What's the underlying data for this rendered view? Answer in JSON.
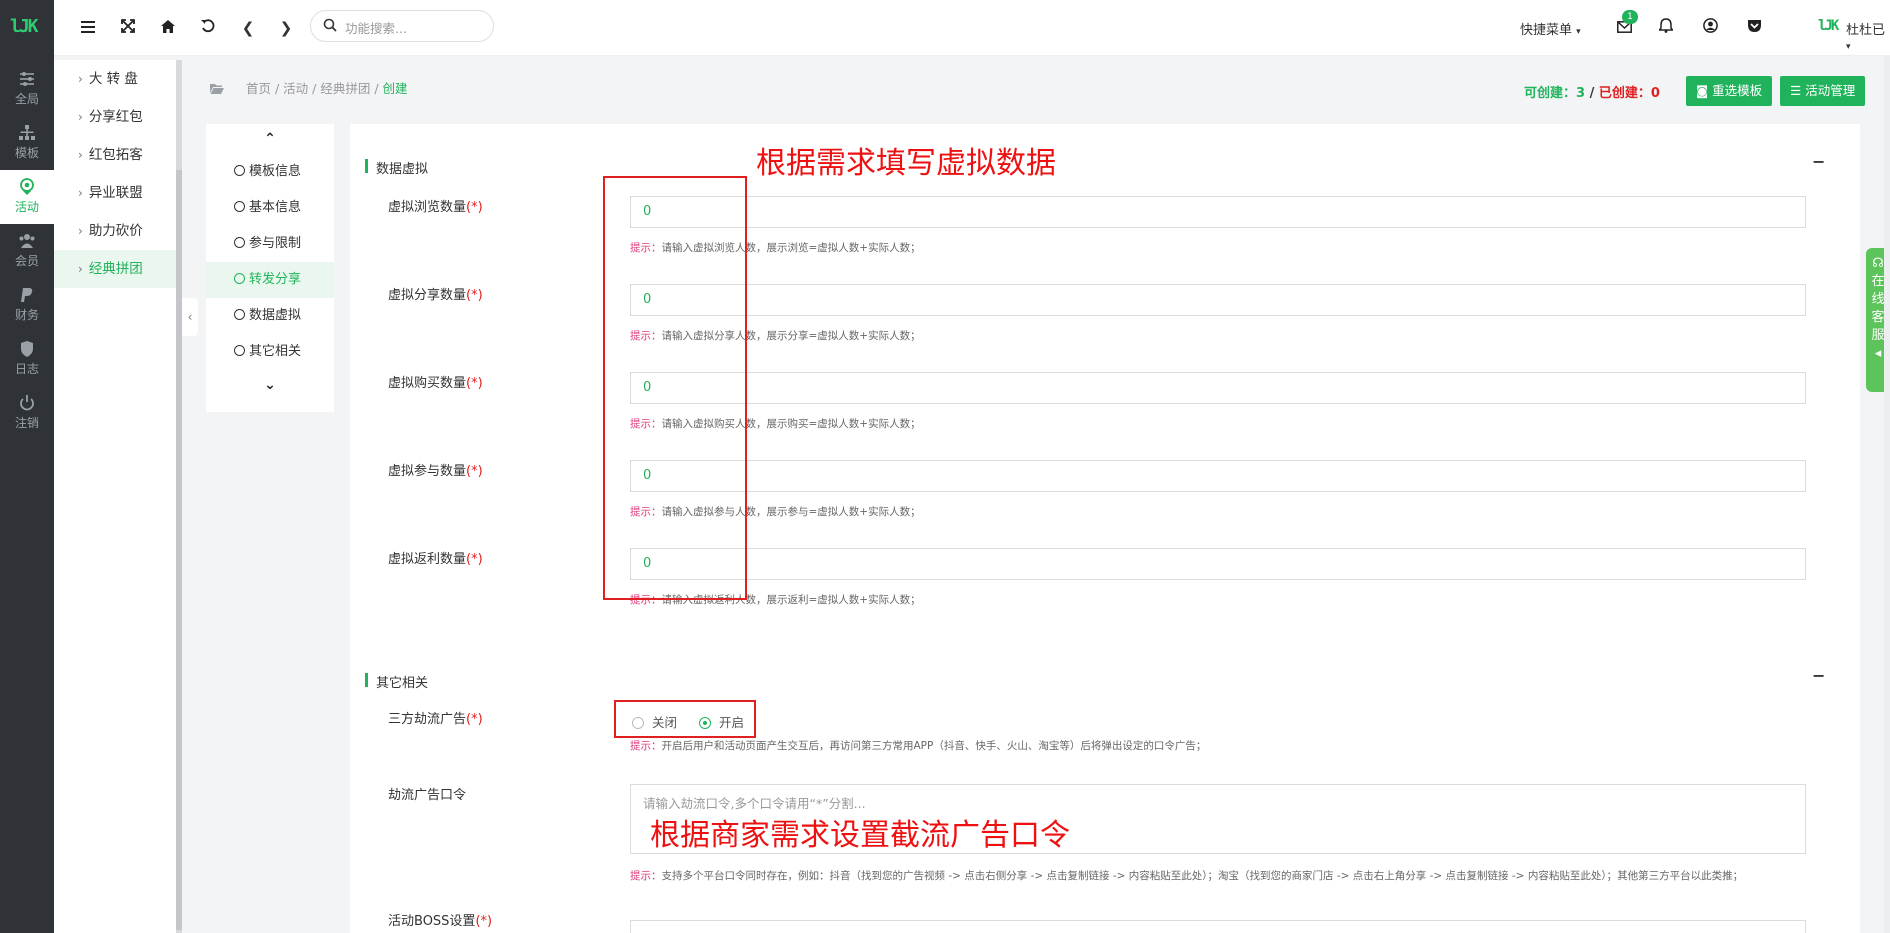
{
  "rail": {
    "items": [
      {
        "label": "全局",
        "icon": "sliders-icon"
      },
      {
        "label": "模板",
        "icon": "sitemap-icon"
      },
      {
        "label": "活动",
        "icon": "location-pin-icon"
      },
      {
        "label": "会员",
        "icon": "users-icon"
      },
      {
        "label": "财务",
        "icon": "paypal-icon"
      },
      {
        "label": "日志",
        "icon": "shield-icon"
      },
      {
        "label": "注销",
        "icon": "power-icon"
      }
    ],
    "active_index": 2
  },
  "submenu": {
    "items": [
      "大 转 盘",
      "分享红包",
      "红包拓客",
      "异业联盟",
      "助力砍价",
      "经典拼团"
    ],
    "active_index": 5
  },
  "topbar": {
    "search_placeholder": "功能搜索...",
    "quick_menu": "快捷菜单",
    "mail_badge": "1",
    "user_name": "杜杜已"
  },
  "breadcrumb": {
    "items": [
      "首页",
      "活动",
      "经典拼团"
    ],
    "current": "创建"
  },
  "quota": {
    "can_create_label": "可创建：",
    "can_create_value": "3",
    "created_label": "已创建：",
    "created_value": "0"
  },
  "actions": {
    "reselect_template": "重选模板",
    "activity_manage": "活动管理"
  },
  "steps": {
    "items": [
      "模板信息",
      "基本信息",
      "参与限制",
      "转发分享",
      "数据虚拟",
      "其它相关"
    ],
    "active_index": 3
  },
  "virtual": {
    "title": "数据虚拟",
    "fields": [
      {
        "label": "虚拟浏览数量",
        "value": "0",
        "hint": "请输入虚拟浏览人数，展示浏览=虚拟人数+实际人数；"
      },
      {
        "label": "虚拟分享数量",
        "value": "0",
        "hint": "请输入虚拟分享人数，展示分享=虚拟人数+实际人数；"
      },
      {
        "label": "虚拟购买数量",
        "value": "0",
        "hint": "请输入虚拟购买人数，展示购买=虚拟人数+实际人数；"
      },
      {
        "label": "虚拟参与数量",
        "value": "0",
        "hint": "请输入虚拟参与人数，展示参与=虚拟人数+实际人数；"
      },
      {
        "label": "虚拟返利数量",
        "value": "0",
        "hint": "请输入虚拟返利人数，展示返利=虚拟人数+实际人数；"
      }
    ]
  },
  "other": {
    "title": "其它相关",
    "ad_label": "三方劫流广告",
    "ad_options": [
      "关闭",
      "开启"
    ],
    "ad_selected": "开启",
    "ad_hint": "开启后用户和活动页面产生交互后，再访问第三方常用APP（抖音、快手、火山、淘宝等）后将弹出设定的口令广告；",
    "cmd_label": "劫流广告口令",
    "cmd_placeholder": "请输入劫流口令,多个口令请用“*”分割...",
    "cmd_hint": "支持多个平台口令同时存在，例如：抖音（找到您的广告视频 -> 点击右侧分享 -> 点击复制链接 -> 内容粘贴至此处）；淘宝（找到您的商家门店 -> 点击右上角分享 -> 点击复制链接 -> 内容粘贴至此处）；其他第三方平台以此类推；",
    "boss_label": "活动BOSS设置"
  },
  "common": {
    "required_mark": "(*)",
    "tip_label": "提示：",
    "collapse_symbol": "−"
  },
  "annotations": {
    "virtual_note": "根据需求填写虚拟数据",
    "command_note": "根据商家需求设置截流广告口令"
  },
  "service": {
    "label_chars": [
      "在",
      "线",
      "客",
      "服"
    ]
  }
}
